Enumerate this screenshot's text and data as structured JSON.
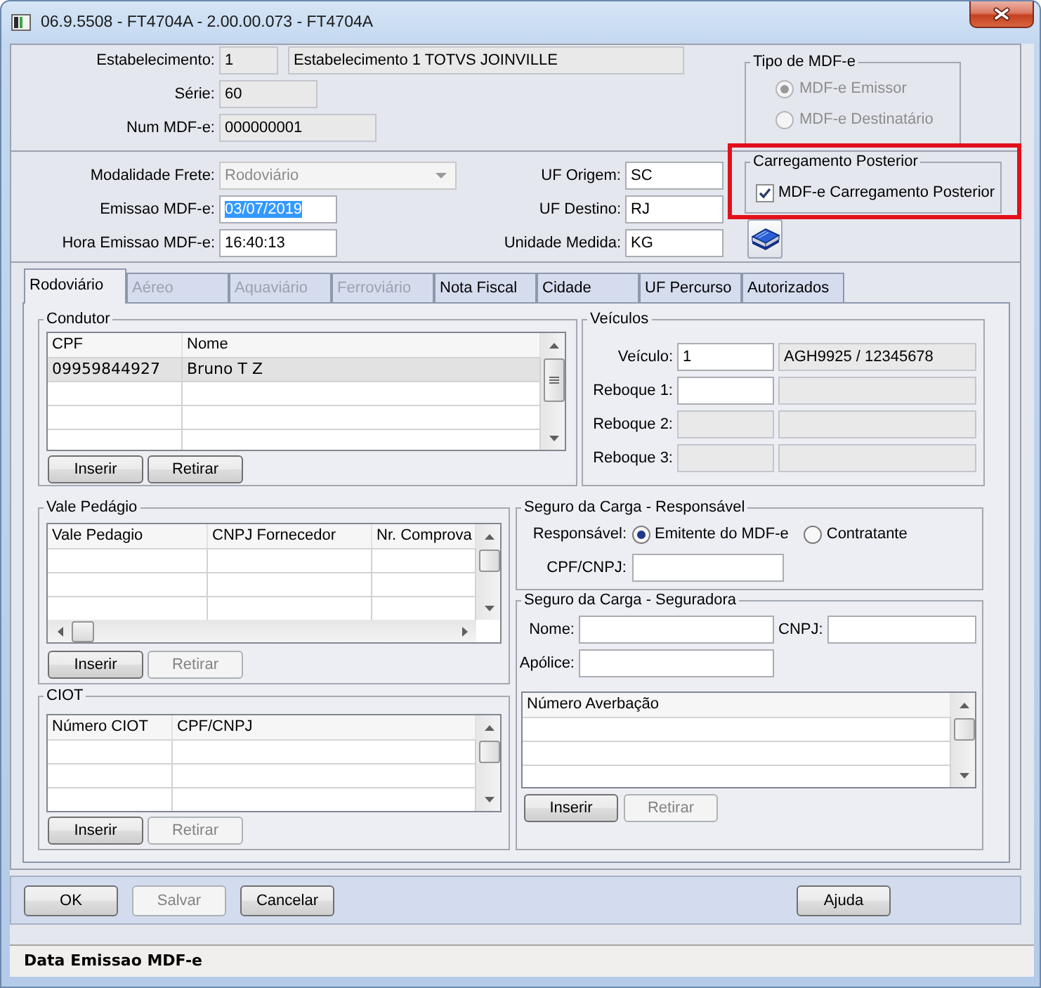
{
  "window": {
    "title": "06.9.5508 - FT4704A - 2.00.00.073 - FT4704A"
  },
  "header": {
    "fields": [
      {
        "label": "Estabelecimento:",
        "value": "1",
        "description": "Estabelecimento 1 TOTVS JOINVILLE"
      },
      {
        "label": "Série:",
        "value": "60"
      },
      {
        "label": "Num MDF-e:",
        "value": "000000001"
      }
    ],
    "tipo_mdfe": {
      "title": "Tipo de MDF-e",
      "disabled": true,
      "options": [
        {
          "label": "MDF-e Emissor",
          "selected": true
        },
        {
          "label": "MDF-e Destinatário",
          "selected": false
        }
      ]
    }
  },
  "transport": {
    "left_fields": [
      {
        "kind": "dropdown",
        "label": "Modalidade Frete:",
        "value": "Rodoviário",
        "disabled": true
      },
      {
        "kind": "text",
        "label": "Emissao MDF-e:",
        "value": "03/07/2019",
        "text_selected": true
      },
      {
        "kind": "text",
        "label": "Hora Emissao MDF-e:",
        "value": "16:40:13",
        "text_selected": false
      }
    ],
    "right_fields": [
      {
        "label": "UF Origem:",
        "value": "SC"
      },
      {
        "label": "UF Destino:",
        "value": "RJ"
      },
      {
        "label": "Unidade Medida:",
        "value": "KG"
      }
    ],
    "carregamento": {
      "title": "Carregamento Posterior",
      "highlighted": true,
      "checkbox": {
        "label": "MDF-e Carregamento Posterior",
        "checked": true
      }
    }
  },
  "tabs": [
    {
      "label": "Rodoviário",
      "selected": true,
      "disabled": false
    },
    {
      "label": "Aéreo",
      "selected": false,
      "disabled": true
    },
    {
      "label": "Aquaviário",
      "selected": false,
      "disabled": true
    },
    {
      "label": "Ferroviário",
      "selected": false,
      "disabled": true
    },
    {
      "label": "Nota Fiscal",
      "selected": false,
      "disabled": false
    },
    {
      "label": "Cidade",
      "selected": false,
      "disabled": false
    },
    {
      "label": "UF Percurso",
      "selected": false,
      "disabled": false
    },
    {
      "label": "Autorizados",
      "selected": false,
      "disabled": false
    }
  ],
  "condutor": {
    "title": "Condutor",
    "columns": [
      "CPF",
      "Nome"
    ],
    "rows": [
      {
        "cells": [
          "09959844927",
          "Bruno T Z"
        ],
        "selected": true
      }
    ],
    "buttons": [
      {
        "label": "Inserir",
        "disabled": false
      },
      {
        "label": "Retirar",
        "disabled": false
      }
    ]
  },
  "veiculos": {
    "title": "Veículos",
    "rows": [
      {
        "label": "Veículo:",
        "value": "1",
        "description": "AGH9925 / 12345678",
        "editable": true
      },
      {
        "label": "Reboque 1:",
        "editable": true
      },
      {
        "label": "Reboque 2:",
        "editable": false
      },
      {
        "label": "Reboque 3:",
        "editable": false
      }
    ]
  },
  "vale_pedagio": {
    "title": "Vale Pedágio",
    "columns": [
      "Vale Pedagio",
      "CNPJ Fornecedor",
      "Nr. Comprova"
    ],
    "buttons": [
      {
        "label": "Inserir",
        "disabled": false
      },
      {
        "label": "Retirar",
        "disabled": true
      }
    ]
  },
  "seguro_responsavel": {
    "title": "Seguro da Carga - Responsável",
    "responsavel": {
      "label": "Responsável:",
      "options": [
        {
          "label": "Emitente do MDF-e",
          "selected": true
        },
        {
          "label": "Contratante",
          "selected": false
        }
      ]
    },
    "cpf_cnpj": {
      "label": "CPF/CNPJ:"
    }
  },
  "seguro_seguradora": {
    "title": "Seguro da Carga - Seguradora",
    "field_rows": [
      [
        {
          "label": "Nome:"
        },
        {
          "label": "CNPJ:"
        }
      ],
      [
        {
          "label": "Apólice:"
        }
      ]
    ],
    "columns": [
      "Número Averbação"
    ],
    "buttons": [
      {
        "label": "Inserir",
        "disabled": false
      },
      {
        "label": "Retirar",
        "disabled": true
      }
    ]
  },
  "ciot": {
    "title": "CIOT",
    "columns": [
      "Número CIOT",
      "CPF/CNPJ"
    ],
    "buttons": [
      {
        "label": "Inserir",
        "disabled": false
      },
      {
        "label": "Retirar",
        "disabled": true
      }
    ]
  },
  "footer": {
    "left_buttons": [
      {
        "label": "OK",
        "disabled": false
      },
      {
        "label": "Salvar",
        "disabled": true
      },
      {
        "label": "Cancelar",
        "disabled": false
      }
    ],
    "right_buttons": [
      {
        "label": "Ajuda",
        "disabled": false
      }
    ]
  },
  "status_bar": {
    "text": "Data Emissao MDF-e"
  }
}
